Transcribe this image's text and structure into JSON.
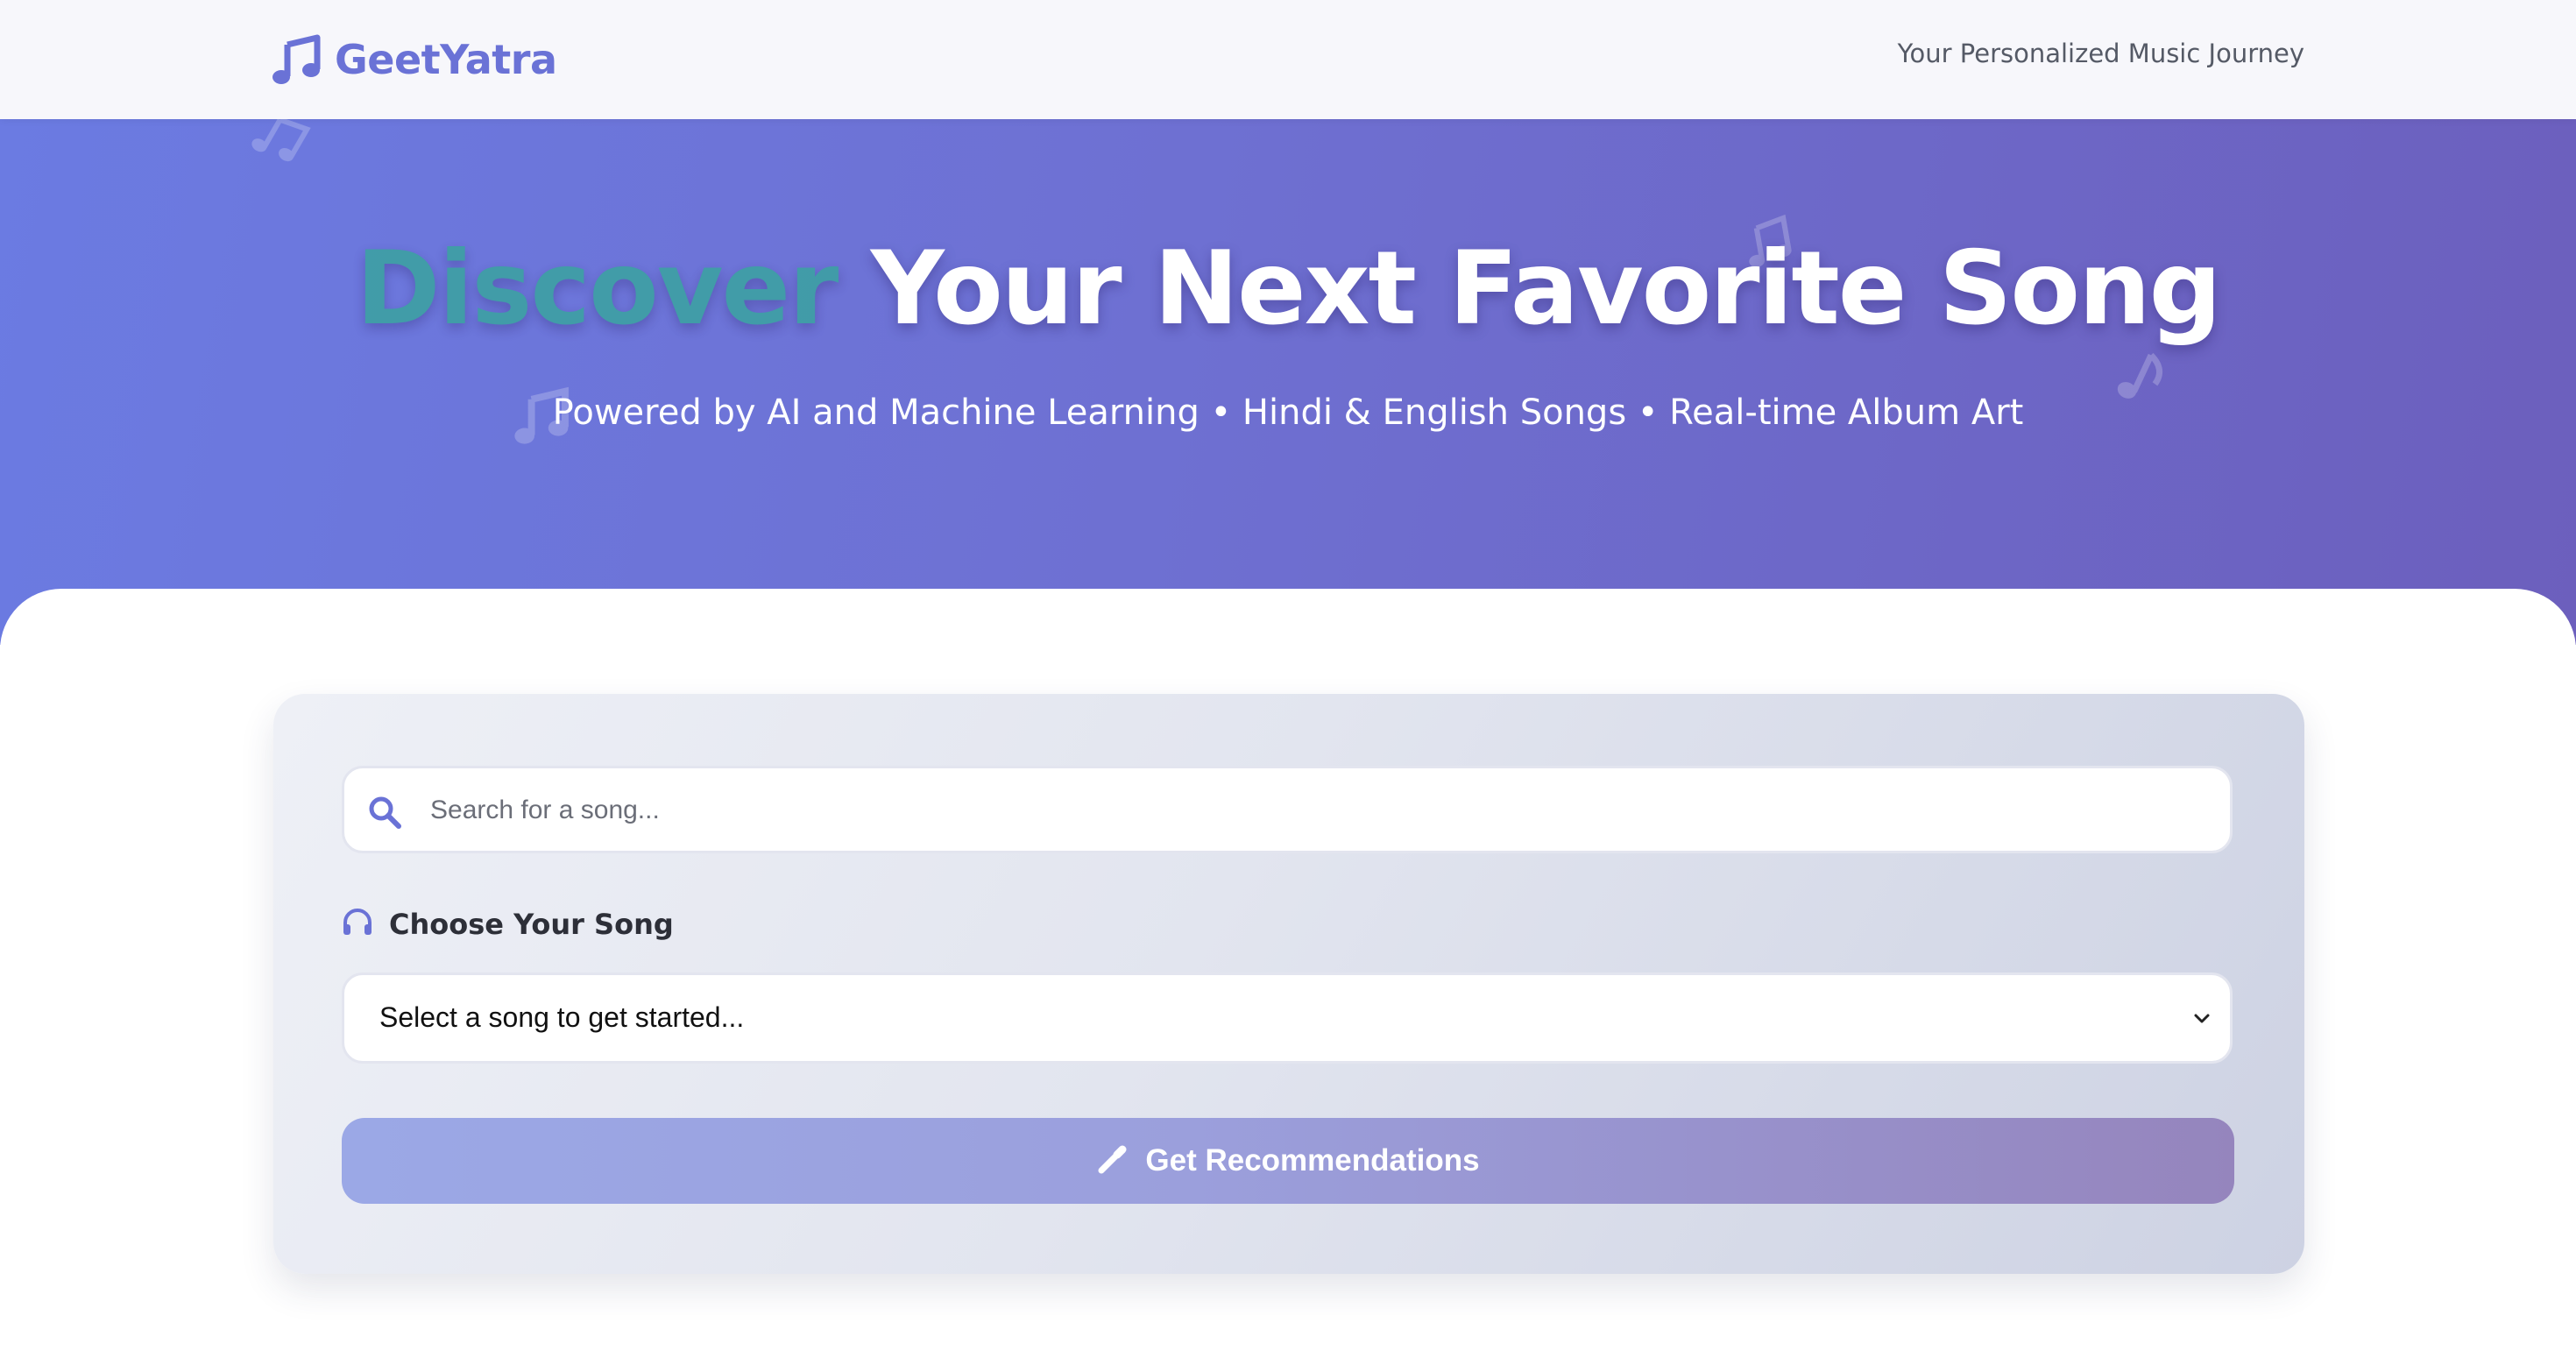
{
  "header": {
    "brand": "GeetYatra",
    "tagline": "Your Personalized Music Journey"
  },
  "hero": {
    "title_accent": "Discover",
    "title_rest": " Your Next Favorite Song",
    "subtitle": "Powered by AI and Machine Learning • Hindi & English Songs • Real-time Album Art"
  },
  "search": {
    "placeholder": "Search for a song..."
  },
  "song_select": {
    "label": "Choose Your Song",
    "selected": "Select a song to get started..."
  },
  "actions": {
    "recommend_label": "Get Recommendations"
  },
  "icons": {
    "brand": "music-note-icon",
    "search": "search-icon",
    "choose": "headphones-icon",
    "select": "chevron-down-icon",
    "button": "magic-wand-icon"
  },
  "colors": {
    "brand": "#6a72d6",
    "hero_start": "#6b7be2",
    "hero_end": "#6c5fbd",
    "accent_text": "#3aa3a0",
    "button_start": "#9ba8e6",
    "button_end": "#9585bd"
  }
}
